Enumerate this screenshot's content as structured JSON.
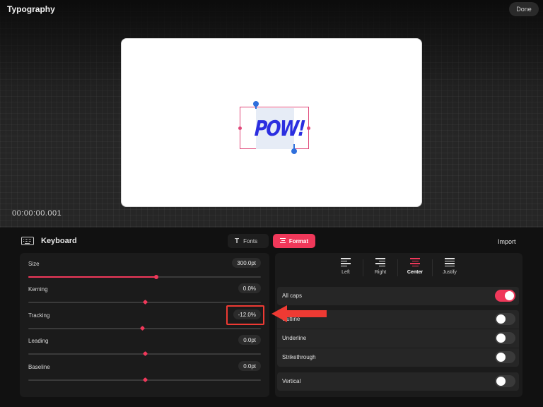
{
  "header": {
    "title": "Typography",
    "done_label": "Done"
  },
  "canvas": {
    "text": "POW!",
    "timecode": "00:00:00.001"
  },
  "panel": {
    "keyboard_label": "Keyboard",
    "tabs": [
      {
        "label": "Fonts",
        "icon": "text-T-icon",
        "active": false
      },
      {
        "label": "Format",
        "icon": "align-center-icon",
        "active": true
      }
    ],
    "import_label": "Import"
  },
  "sliders": [
    {
      "label": "Size",
      "value": "300.0pt",
      "level": 0.55
    },
    {
      "label": "Kerning",
      "value": "0.0%",
      "level": 0.5
    },
    {
      "label": "Tracking",
      "value": "-12.0%",
      "level": 0.49
    },
    {
      "label": "Leading",
      "value": "0.0pt",
      "level": 0.5
    },
    {
      "label": "Baseline",
      "value": "0.0pt",
      "level": 0.5
    }
  ],
  "alignment": [
    {
      "label": "Left",
      "icon": "align-left-icon",
      "active": false
    },
    {
      "label": "Right",
      "icon": "align-right-icon",
      "active": false
    },
    {
      "label": "Center",
      "icon": "align-center-icon",
      "active": true
    },
    {
      "label": "Justify",
      "icon": "align-justify-icon",
      "active": false
    }
  ],
  "toggles": [
    {
      "label": "All caps",
      "on": true
    },
    {
      "label": "Outline",
      "on": false
    },
    {
      "label": "Underline",
      "on": false
    },
    {
      "label": "Strikethrough",
      "on": false
    },
    {
      "label": "Vertical",
      "on": false
    }
  ],
  "colors": {
    "accent": "#f0385a",
    "text_color": "#2b2ee0",
    "annotation": "#ee3a33"
  }
}
